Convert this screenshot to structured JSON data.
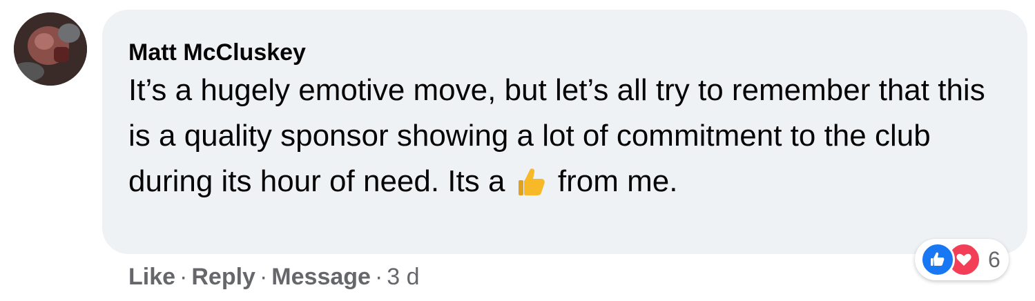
{
  "comment": {
    "author": "Matt McCluskey",
    "text_before_emoji": "It’s a hugely emotive move, but let’s all try to remember that this is a quality sponsor showing a lot of commitment to the club during its hour of need. Its a",
    "text_after_emoji": " from me.",
    "inline_emoji": "thumbs-up-emoji",
    "timestamp": "3 d"
  },
  "actions": {
    "like_label": "Like",
    "reply_label": "Reply",
    "message_label": "Message",
    "separator": "·"
  },
  "reactions": {
    "icons": [
      "like-reaction-icon",
      "love-reaction-icon"
    ],
    "count": "6"
  },
  "colors": {
    "bubble_bg": "#eff2f5",
    "text": "#050505",
    "secondary_text": "#65676b",
    "like_blue": "#1877f2",
    "love_red": "#f33e58",
    "emoji_yellow": "#f7b928"
  }
}
